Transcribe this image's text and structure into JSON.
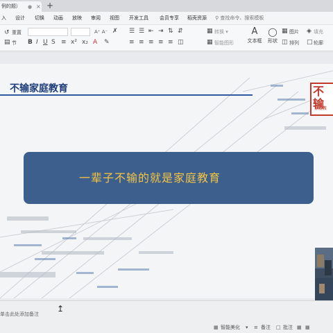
{
  "window": {
    "doc_tab_title": "例的题）",
    "tab_dot": "●",
    "tab_close": "×",
    "tab_add": "+"
  },
  "menu": {
    "items": [
      "入",
      "设计",
      "切换",
      "动画",
      "放映",
      "审阅",
      "视图",
      "开发工具",
      "会员专享",
      "稻壳资源"
    ],
    "search_placeholder": "查找命令、搜索模板"
  },
  "ribbon": {
    "reset_label": "重置",
    "section_label": "节",
    "font_size_text": "A⁺ A⁻",
    "convert_label": "转换 ▾",
    "smartart_label": "智能图形",
    "textbox_label": "文本框",
    "shape_label": "形状",
    "arrange_label": "排列",
    "picture_label": "图片",
    "fill_label": "填充",
    "outline_label": "轮廓"
  },
  "slide": {
    "title": "不输家庭教育",
    "banner_text": "一辈子不输的就是家庭教育",
    "logo_mark": "不输",
    "logo_text": "家庭教"
  },
  "status": {
    "notes_placeholder": "单击此处添加备注",
    "beautify_label": "智能美化",
    "notes_label": "备注",
    "comment_label": "批注"
  },
  "colors": {
    "title": "#1f3f7a",
    "banner_bg": "#3d5f8e",
    "banner_text": "#f5c542",
    "logo_red": "#c0392b"
  }
}
